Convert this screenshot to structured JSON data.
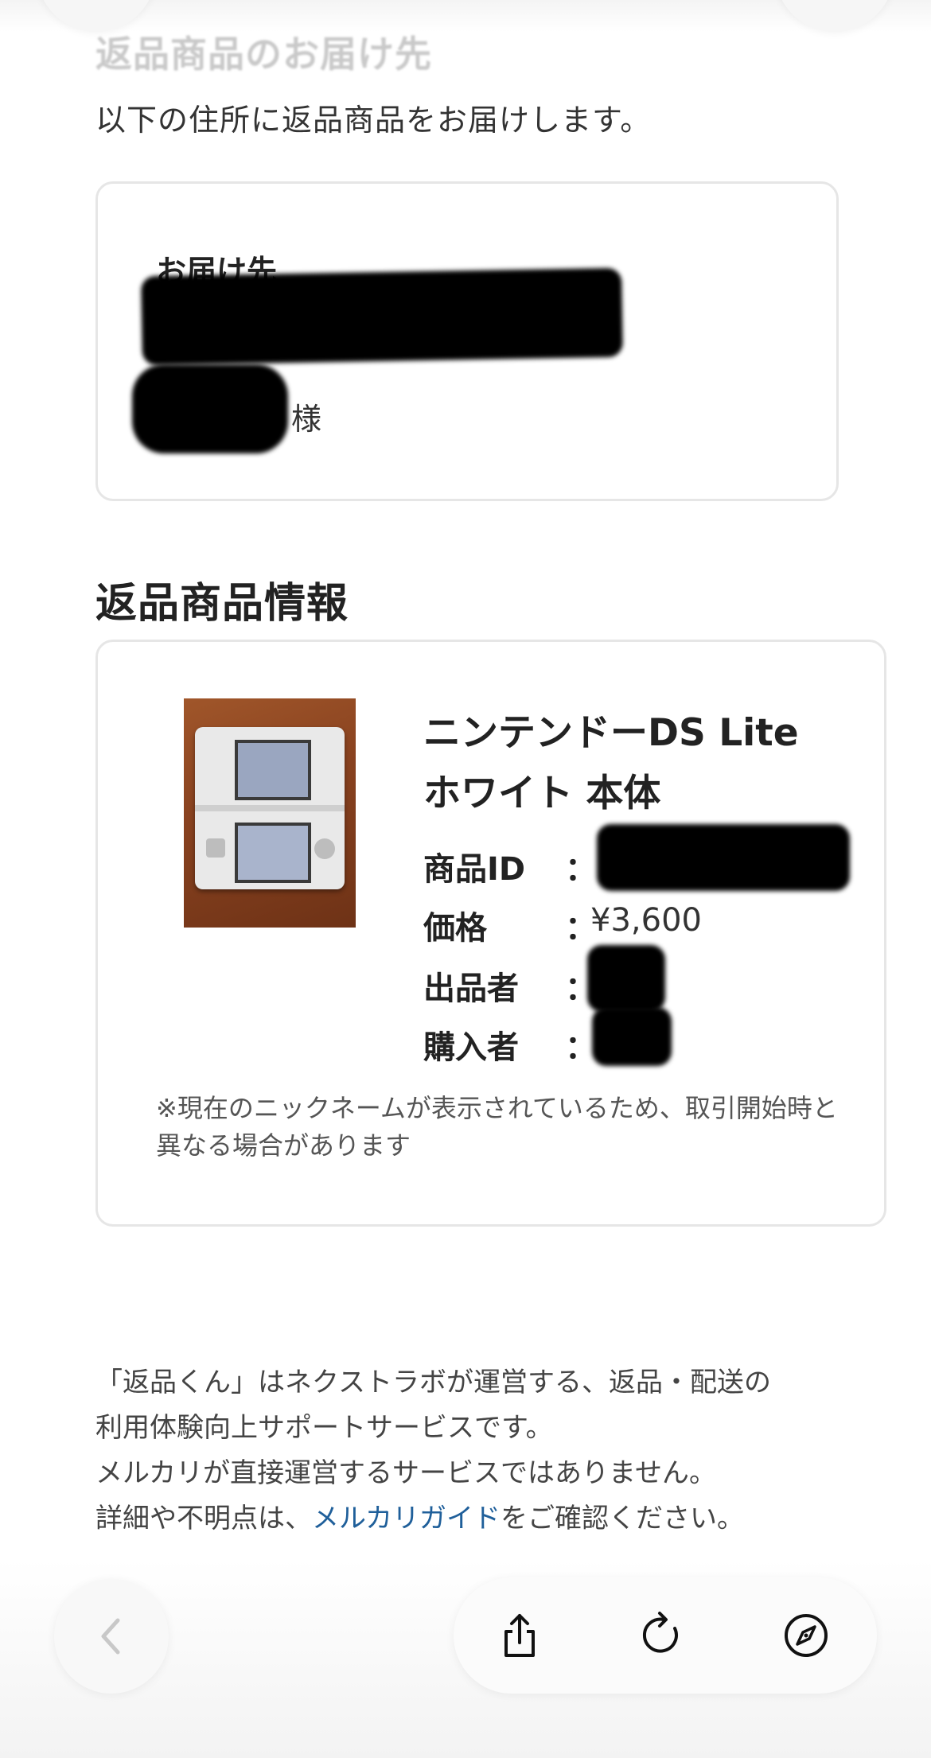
{
  "return_address": {
    "heading": "返品商品のお届け先",
    "intro": "以下の住所に返品商品をお届けします。",
    "label": "お届け先",
    "name_suffix": "様"
  },
  "return_item": {
    "section_title": "返品商品情報",
    "product_name": "ニンテンドーDS Lite ホワイト 本体",
    "fields": {
      "id_label": "商品ID",
      "price_label": "価格",
      "seller_label": "出品者",
      "buyer_label": "購入者",
      "colon": "：",
      "price_value": "¥3,600"
    },
    "note": "※現在のニックネームが表示されているため、取引開始時と異なる場合があります"
  },
  "footer": {
    "line1": "「返品くん」はネクストラボが運営する、返品・配送の",
    "line2": "利用体験向上サポートサービスです。",
    "line3": "メルカリが直接運営するサービスではありません。",
    "line4_prefix": "詳細や不明点は、",
    "line4_link": "メルカリガイド",
    "line4_suffix": "をご確認ください。"
  },
  "toolbar": {
    "back_icon": "chevron-left-icon",
    "share_icon": "share-icon",
    "reload_icon": "reload-icon",
    "browser_icon": "compass-icon"
  },
  "colors": {
    "link": "#1f5f9a",
    "card_border": "#e6e6e6",
    "text_primary": "#222222"
  }
}
